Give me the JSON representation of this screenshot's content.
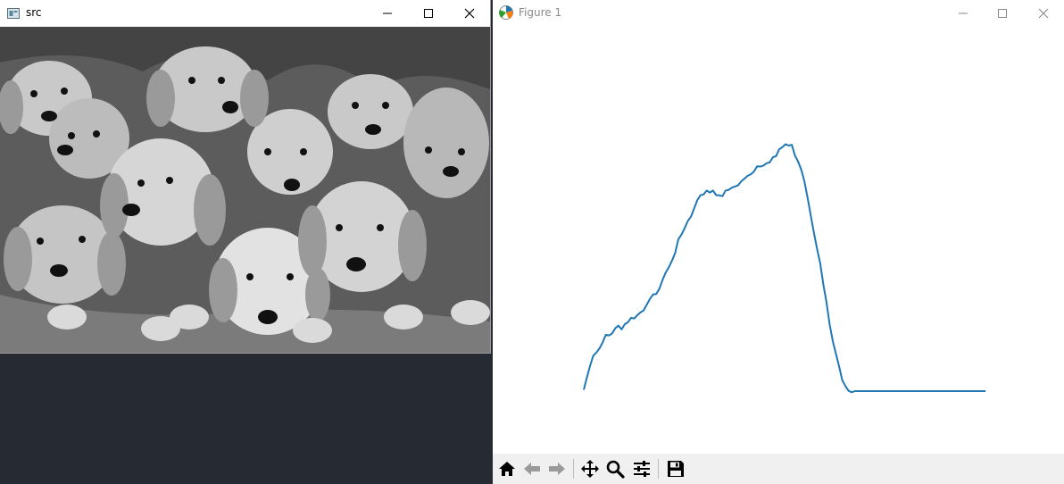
{
  "src_window": {
    "title": "src",
    "controls": {
      "minimize": "minimize",
      "maximize": "maximize",
      "close": "close"
    },
    "image_description_icon": "image-icon"
  },
  "figure_window": {
    "title": "Figure 1",
    "app_icon": "matplotlib-icon",
    "toolbar": [
      {
        "name": "home",
        "icon": "home-icon"
      },
      {
        "name": "back",
        "icon": "back-arrow-icon"
      },
      {
        "name": "forward",
        "icon": "forward-arrow-icon"
      },
      {
        "name": "pan",
        "icon": "move-icon"
      },
      {
        "name": "zoom",
        "icon": "zoom-icon"
      },
      {
        "name": "configure",
        "icon": "sliders-icon"
      },
      {
        "name": "save",
        "icon": "save-icon"
      }
    ]
  },
  "colors": {
    "line": "#1f77b4",
    "desktop": "#262a33",
    "toolbar": "#f0f0f0"
  },
  "chart_data": {
    "type": "line",
    "xlim": [
      0,
      256
    ],
    "ylim": [
      0,
      4500
    ],
    "grid": false,
    "axes_visible": false,
    "x": [
      0,
      2,
      4,
      6,
      8,
      10,
      12,
      14,
      16,
      18,
      20,
      22,
      24,
      26,
      28,
      30,
      32,
      34,
      36,
      38,
      40,
      42,
      44,
      46,
      48,
      50,
      52,
      54,
      56,
      58,
      60,
      62,
      64,
      66,
      68,
      70,
      72,
      74,
      76,
      78,
      80,
      82,
      84,
      86,
      88,
      90,
      92,
      94,
      96,
      98,
      100,
      102,
      104,
      106,
      108,
      110,
      112,
      114,
      116,
      118,
      120,
      122,
      124,
      126,
      128,
      130,
      132,
      134,
      136,
      138,
      140,
      142,
      144,
      146,
      148,
      150,
      152,
      154,
      156,
      158,
      160,
      162,
      164,
      166,
      168,
      170,
      172,
      174,
      176,
      178,
      180,
      182,
      184,
      186,
      188,
      190,
      192,
      194,
      196,
      198,
      200,
      202,
      204,
      206,
      208,
      210,
      212,
      214,
      216,
      218,
      220,
      222,
      224,
      226,
      228,
      230,
      232,
      234,
      236,
      238,
      240,
      242,
      244,
      246,
      248,
      250,
      252,
      254,
      255
    ],
    "y": [
      20,
      150,
      380,
      500,
      560,
      620,
      700,
      840,
      880,
      900,
      950,
      1000,
      980,
      1010,
      1050,
      1080,
      1040,
      1120,
      1150,
      1200,
      1260,
      1360,
      1420,
      1500,
      1600,
      1720,
      1820,
      1930,
      2020,
      2120,
      2230,
      2320,
      2440,
      2540,
      2620,
      2720,
      2820,
      2900,
      3000,
      3040,
      3020,
      3030,
      2990,
      3000,
      2960,
      2980,
      3020,
      3040,
      3080,
      3100,
      3150,
      3200,
      3260,
      3300,
      3350,
      3400,
      3420,
      3450,
      3480,
      3500,
      3520,
      3540,
      3600,
      3680,
      3720,
      3700,
      3680,
      3600,
      3500,
      3380,
      3200,
      2950,
      2700,
      2450,
      2200,
      1900,
      1600,
      1300,
      1000,
      750,
      520,
      350,
      220,
      120,
      60,
      20,
      0,
      0,
      0,
      0,
      0,
      0,
      0,
      0,
      0,
      0,
      0,
      0,
      0,
      0,
      0,
      0,
      0,
      0,
      0,
      0,
      0,
      0,
      0,
      0,
      0,
      0,
      0,
      0,
      0,
      0,
      0,
      0,
      0,
      0,
      0,
      0,
      0,
      0,
      0,
      0,
      0,
      0,
      0
    ]
  }
}
